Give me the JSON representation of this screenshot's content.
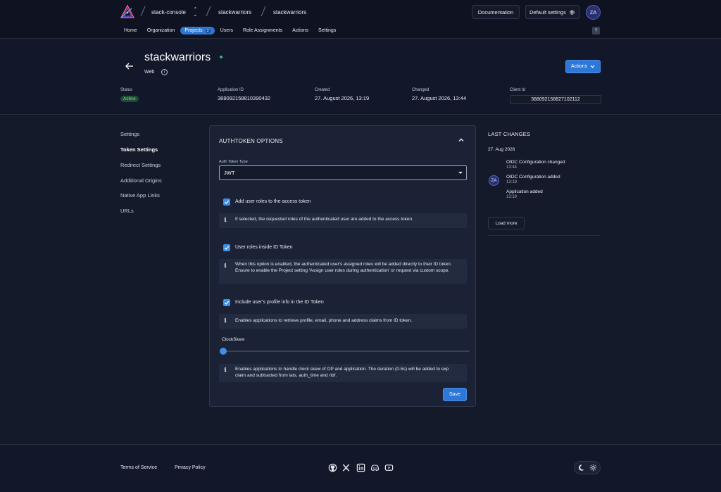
{
  "header": {
    "crumbs": [
      "stack-console",
      "stackwarriors",
      "stackwarriors"
    ],
    "documentation_label": "Documentation",
    "default_settings_label": "Default settings",
    "avatar_initials": "ZA",
    "help_label": "?"
  },
  "nav": {
    "items": [
      "Home",
      "Organization",
      "Projects",
      "Users",
      "Role Assignments",
      "Actions",
      "Settings"
    ],
    "projects_count": "2",
    "active": "Projects"
  },
  "app": {
    "title": "stackwarriors",
    "type": "Web",
    "actions_label": "Actions",
    "status_label": "Status",
    "status_value": "Active",
    "app_id_label": "Application ID",
    "app_id_value": "388092158810390432",
    "created_label": "Created",
    "created_value": "27. August 2026, 13:19",
    "changed_label": "Changed",
    "changed_value": "27. August 2026, 13:44",
    "client_id_label": "Client Id",
    "client_id_value": "388092158827102112"
  },
  "sidebar": {
    "items": [
      "Settings",
      "Token Settings",
      "Redirect Settings",
      "Additional Origins",
      "Native App Links",
      "URLs"
    ],
    "active": "Token Settings"
  },
  "card": {
    "title": "AUTHTOKEN OPTIONS",
    "auth_token_type_label": "Auth Token Type",
    "auth_token_type_value": "JWT",
    "option1_label": "Add user roles to the access token",
    "option1_info": "If selected, the requested roles of the authenticated user are added to the access token.",
    "option2_label": "User roles inside ID Token",
    "option2_info": "When this option is enabled, the authenticated user's assigned roles will be added directly to their ID token. Ensure to enable the Project setting 'Assign user roles during authentication' or request via custom scope.",
    "option3_label": "Include user's profile info in the ID Token",
    "option3_info": "Enables applications to retrieve profile, email, phone and address claims from ID token.",
    "clockskew_label": "ClockSkew",
    "clockskew_value": 0,
    "clockskew_info": "Enables applications to handle clock skew of OP and application. The duration (0-5s) will be added to exp claim and subtracted from iats, auth_time and nbf.",
    "save_label": "Save"
  },
  "last_changes": {
    "title": "LAST CHANGES",
    "date": "27. Aug 2026",
    "avatar_initials": "ZA",
    "entries": [
      {
        "label": "OIDC Configuration changed",
        "time": "13:44"
      },
      {
        "label": "OIDC Configuration added",
        "time": "13:19"
      },
      {
        "label": "Application added",
        "time": "13:19"
      }
    ],
    "load_more_label": "Load more"
  },
  "footer": {
    "terms_label": "Terms of Service",
    "privacy_label": "Privacy Policy",
    "social_icons": [
      "github-icon",
      "x-icon",
      "linkedin-icon",
      "discord-icon",
      "youtube-icon"
    ]
  },
  "colors": {
    "accent": "#2d77d6",
    "background": "#151a2a",
    "card": "#1b2236",
    "status_active": "#7ee0a8"
  }
}
